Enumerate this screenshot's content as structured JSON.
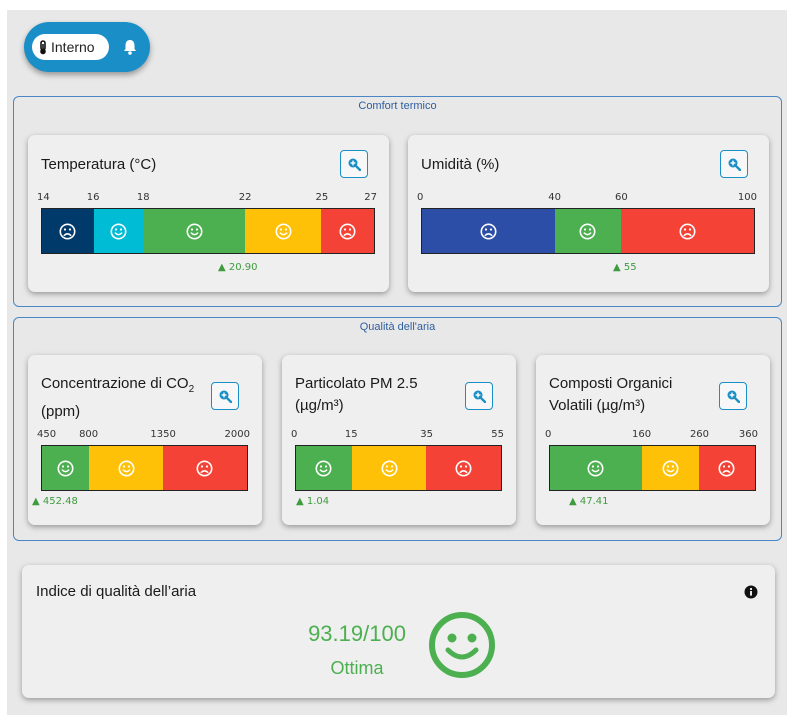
{
  "toggle": {
    "label": "Interno",
    "left_icon": "thermometer-icon",
    "right_icon": "bell-icon"
  },
  "sections": {
    "thermal": {
      "title": "Comfort termico"
    },
    "air": {
      "title": "Qualità dell'aria"
    }
  },
  "cards": {
    "temperature": {
      "title": "Temperatura (°C)",
      "ticks": [
        "14",
        "16",
        "18",
        "22",
        "25",
        "27"
      ],
      "segments": [
        {
          "color": "#003a6b",
          "face": "sad"
        },
        {
          "color": "#00bcd4",
          "face": "smile"
        },
        {
          "color": "#4caf50",
          "face": "smile"
        },
        {
          "color": "#ffc107",
          "face": "smile"
        },
        {
          "color": "#f44336",
          "face": "sad"
        }
      ],
      "marker": "▲ 20.90"
    },
    "humidity": {
      "title": "Umidità (%)",
      "ticks": [
        "0",
        "40",
        "60",
        "100"
      ],
      "segments": [
        {
          "color": "#2c4ea6",
          "face": "sad"
        },
        {
          "color": "#4caf50",
          "face": "smile"
        },
        {
          "color": "#f44336",
          "face": "sad"
        }
      ],
      "marker": "▲ 55"
    },
    "co2": {
      "title_line1": "Concentrazione di CO",
      "title_sub": "2",
      "title_line2": "(ppm)",
      "ticks": [
        "450",
        "800",
        "1350",
        "2000"
      ],
      "segments": [
        {
          "color": "#4caf50",
          "face": "smile"
        },
        {
          "color": "#ffc107",
          "face": "smile"
        },
        {
          "color": "#f44336",
          "face": "sad"
        }
      ],
      "marker": "▲ 452.48"
    },
    "pm25": {
      "title_line1": "Particolato PM 2.5",
      "title_line2": "(µg/m³)",
      "ticks": [
        "0",
        "15",
        "35",
        "55"
      ],
      "segments": [
        {
          "color": "#4caf50",
          "face": "smile"
        },
        {
          "color": "#ffc107",
          "face": "smile"
        },
        {
          "color": "#f44336",
          "face": "sad"
        }
      ],
      "marker": "▲ 1.04"
    },
    "voc": {
      "title_line1": "Composti Organici",
      "title_line2": "Volatili (µg/m³)",
      "ticks": [
        "0",
        "160",
        "260",
        "360"
      ],
      "segments": [
        {
          "color": "#4caf50",
          "face": "smile"
        },
        {
          "color": "#ffc107",
          "face": "smile"
        },
        {
          "color": "#f44336",
          "face": "sad"
        }
      ],
      "marker": "▲ 47.41"
    }
  },
  "aqi": {
    "title": "Indice di qualità dell’aria",
    "value": "93.19/100",
    "label": "Ottima",
    "color": "#4caf50"
  }
}
